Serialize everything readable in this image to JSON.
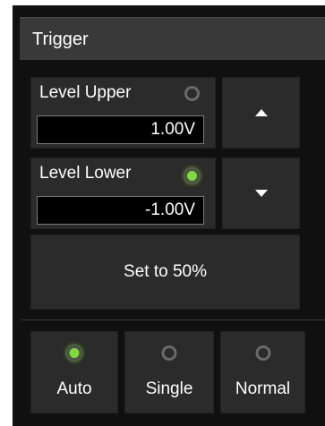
{
  "panel": {
    "title": "Trigger"
  },
  "level_upper": {
    "label": "Level Upper",
    "value": "1.00V",
    "active": false
  },
  "level_lower": {
    "label": "Level Lower",
    "value": "-1.00V",
    "active": true
  },
  "icons": {
    "up": "arrow-up-icon",
    "down": "arrow-down-icon",
    "indicator": "radio-indicator-icon"
  },
  "set_to_50": {
    "label": "Set to 50%"
  },
  "modes": [
    {
      "label": "Auto",
      "selected": true
    },
    {
      "label": "Single",
      "selected": false
    },
    {
      "label": "Normal",
      "selected": false
    }
  ],
  "colors": {
    "background": "#101010",
    "title_bar": "#393939",
    "button": "#2b2b2b",
    "value_box": "#000000",
    "indicator_on": "#7ddc3a",
    "indicator_off": "#6a6a6a",
    "text": "#ffffff"
  }
}
